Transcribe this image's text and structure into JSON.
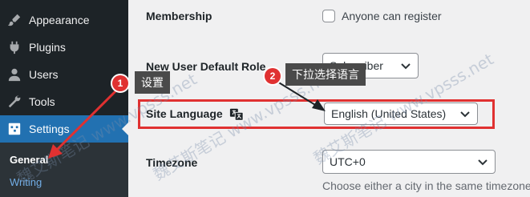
{
  "sidebar": {
    "items": [
      {
        "label": "Appearance",
        "icon": "brush-icon"
      },
      {
        "label": "Plugins",
        "icon": "plug-icon"
      },
      {
        "label": "Users",
        "icon": "user-icon"
      },
      {
        "label": "Tools",
        "icon": "wrench-icon"
      },
      {
        "label": "Settings",
        "icon": "settings-icon"
      }
    ],
    "submenu": [
      {
        "label": "General"
      },
      {
        "label": "Writing"
      }
    ]
  },
  "settings": {
    "membership": {
      "label": "Membership",
      "checkbox_label": "Anyone can register",
      "checked": false
    },
    "default_role": {
      "label": "New User Default Role",
      "value": "Subscriber"
    },
    "site_language": {
      "label": "Site Language",
      "value": "English (United States)"
    },
    "timezone": {
      "label": "Timezone",
      "value": "UTC+0",
      "description": "Choose either a city in the same timezone"
    }
  },
  "annotations": [
    {
      "number": "1",
      "text": "设置"
    },
    {
      "number": "2",
      "text": "下拉选择语言"
    }
  ],
  "watermark": "魏艾斯笔记 www.vpsss.net",
  "colors": {
    "sidebar_bg": "#1d2327",
    "active_bg": "#2271b1",
    "submenu_bg": "#2c3338",
    "link": "#72aee6",
    "annotation_red": "#e03131",
    "tag_bg": "#4a4a4a"
  }
}
